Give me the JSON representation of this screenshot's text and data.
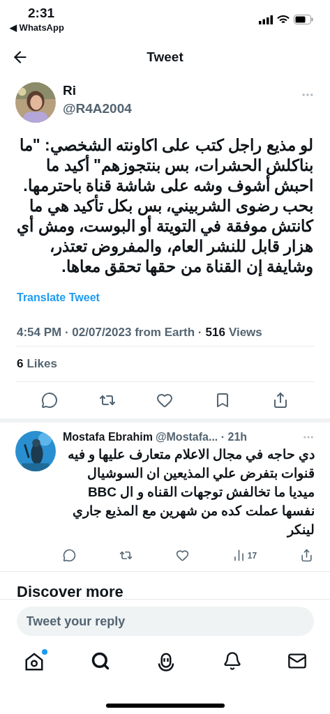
{
  "status_bar": {
    "time": "2:31",
    "back_app": "◀ WhatsApp"
  },
  "header": {
    "title": "Tweet"
  },
  "tweet": {
    "author": {
      "name": "Ri",
      "handle": "@R4A2004"
    },
    "text": "لو مذيع راجل كتب على اكاونته الشخصي: \"ما بناكلش الحشرات، بس بنتجوزهم\" أكيد ما احبش أشوف وشه على شاشة قناة باحترمها. بحب رضوى الشربيني، بس بكل تأكيد هي ما كانتش موفقة في التويتة أو البوست، ومش أي هزار قابل للنشر العام، والمفروض تعتذر، وشايفة إن القناة من حقها تحقق معاها.",
    "translate": "Translate Tweet",
    "meta": {
      "timestamp": "4:54 PM · 02/07/2023 from Earth ·",
      "views_count": "516",
      "views_label": "Views"
    },
    "likes": {
      "count": "6",
      "label": "Likes"
    },
    "actions": [
      {
        "kind": "reply"
      },
      {
        "kind": "retweet"
      },
      {
        "kind": "like"
      },
      {
        "kind": "bookmark"
      },
      {
        "kind": "share"
      }
    ]
  },
  "replies": [
    {
      "name": "Mostafa Ebrahim",
      "meta": "@Mostafa... · 21h",
      "text": "دي حاجه في مجال الاعلام متعارف عليها و فيه قنوات بتفرض علي المذيعين ان السوشيال ميديا ما تخالفش توجهات القناه و ال BBC نفسها عملت كده من شهرين مع المذيع جاري لينكر",
      "actions": [
        {
          "kind": "reply"
        },
        {
          "kind": "retweet"
        },
        {
          "kind": "like"
        },
        {
          "kind": "views",
          "count": "17"
        },
        {
          "kind": "share"
        }
      ]
    }
  ],
  "discover": {
    "title": "Discover more"
  },
  "reply_box": {
    "placeholder": "Tweet your reply"
  },
  "nav": [
    {
      "kind": "home",
      "badge": true
    },
    {
      "kind": "search",
      "badge": false
    },
    {
      "kind": "spaces",
      "badge": false
    },
    {
      "kind": "notifications",
      "badge": false
    },
    {
      "kind": "messages",
      "badge": false
    }
  ]
}
